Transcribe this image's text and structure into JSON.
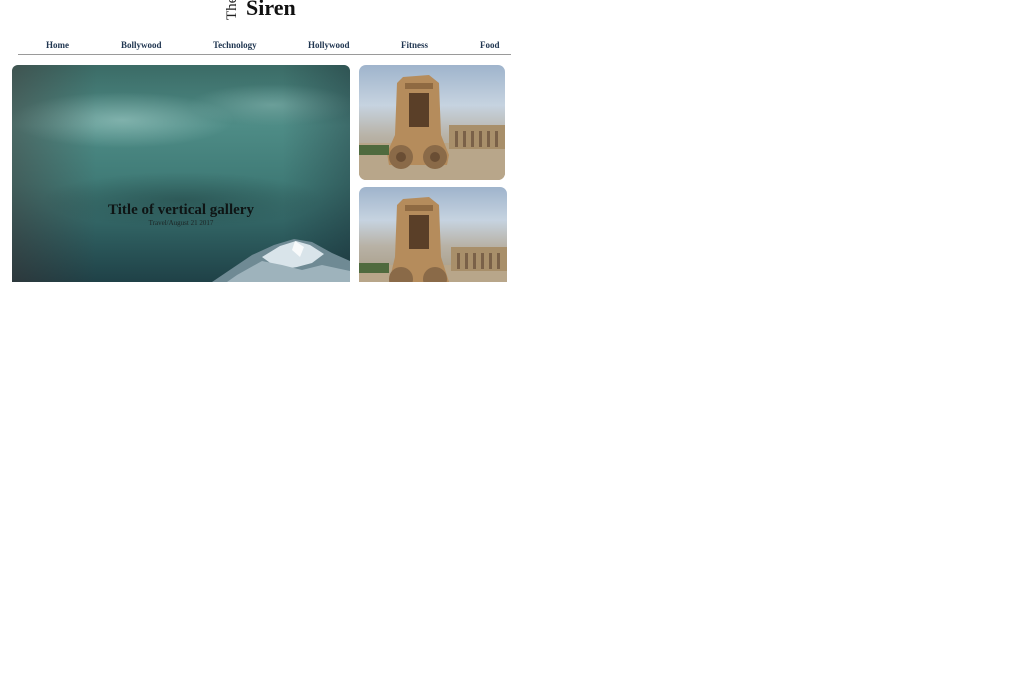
{
  "site": {
    "logo_prefix": "The",
    "logo_name": "Siren"
  },
  "nav": {
    "items": [
      {
        "label": "Home"
      },
      {
        "label": "Bollywood"
      },
      {
        "label": "Technology"
      },
      {
        "label": "Hollywood"
      },
      {
        "label": "Fitness"
      },
      {
        "label": "Food"
      }
    ]
  },
  "hero": {
    "title": "Title of vertical gallery",
    "meta": "Travel/August 21 2017"
  },
  "gallery": {
    "thumbnails": [
      {
        "alt": "stone-chariot-image"
      },
      {
        "alt": "stone-chariot-image"
      }
    ]
  }
}
